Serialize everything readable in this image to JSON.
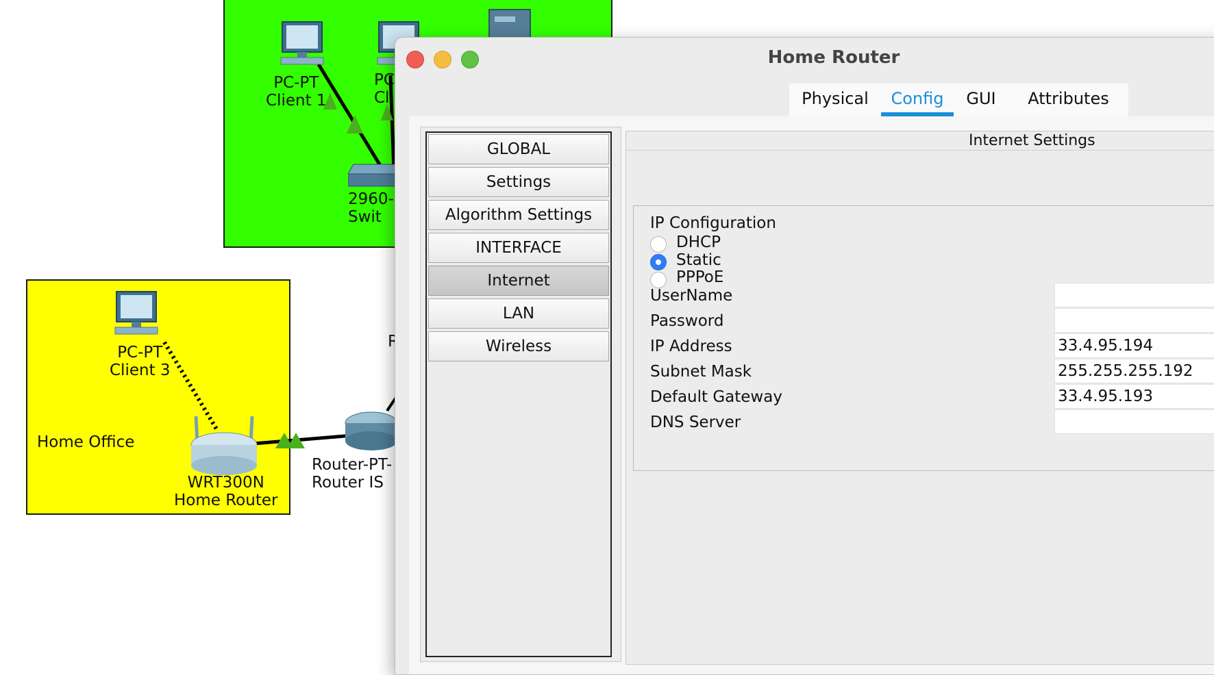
{
  "topology": {
    "zones": [
      {
        "name": "green-zone",
        "label": ""
      },
      {
        "name": "home-office-zone",
        "label": "Home Office"
      }
    ],
    "devices": {
      "client1": "PC-PT\nClient 1",
      "client2": "PC\nCli",
      "switch": "2960-\nSwit",
      "client3": "PC-PT\nClient 3",
      "home_router": "WRT300N\nHome Router",
      "isp_router": "Router-PT-\nRouter IS",
      "partial_r": "R"
    }
  },
  "window": {
    "title": "Home Router",
    "tabs": [
      "Physical",
      "Config",
      "GUI",
      "Attributes"
    ],
    "active_tab": "Config",
    "nav": [
      "GLOBAL",
      "Settings",
      "Algorithm Settings",
      "INTERFACE",
      "Internet",
      "LAN",
      "Wireless"
    ],
    "selected_nav": "Internet"
  },
  "internet_settings": {
    "title": "Internet Settings",
    "ip_config_label": "IP Configuration",
    "options": [
      "DHCP",
      "Static",
      "PPPoE"
    ],
    "selected_option": "Static",
    "fields": [
      {
        "label": "UserName",
        "value": ""
      },
      {
        "label": "Password",
        "value": ""
      },
      {
        "label": "IP Address",
        "value": "33.4.95.194"
      },
      {
        "label": "Subnet Mask",
        "value": "255.255.255.192"
      },
      {
        "label": "Default Gateway",
        "value": "33.4.95.193"
      },
      {
        "label": "DNS Server",
        "value": ""
      }
    ]
  },
  "colors": {
    "accent": "#1a8fd9",
    "green_zone": "#33ff00",
    "yellow_zone": "#ffff00",
    "radio_selected": "#2e7cf6"
  }
}
